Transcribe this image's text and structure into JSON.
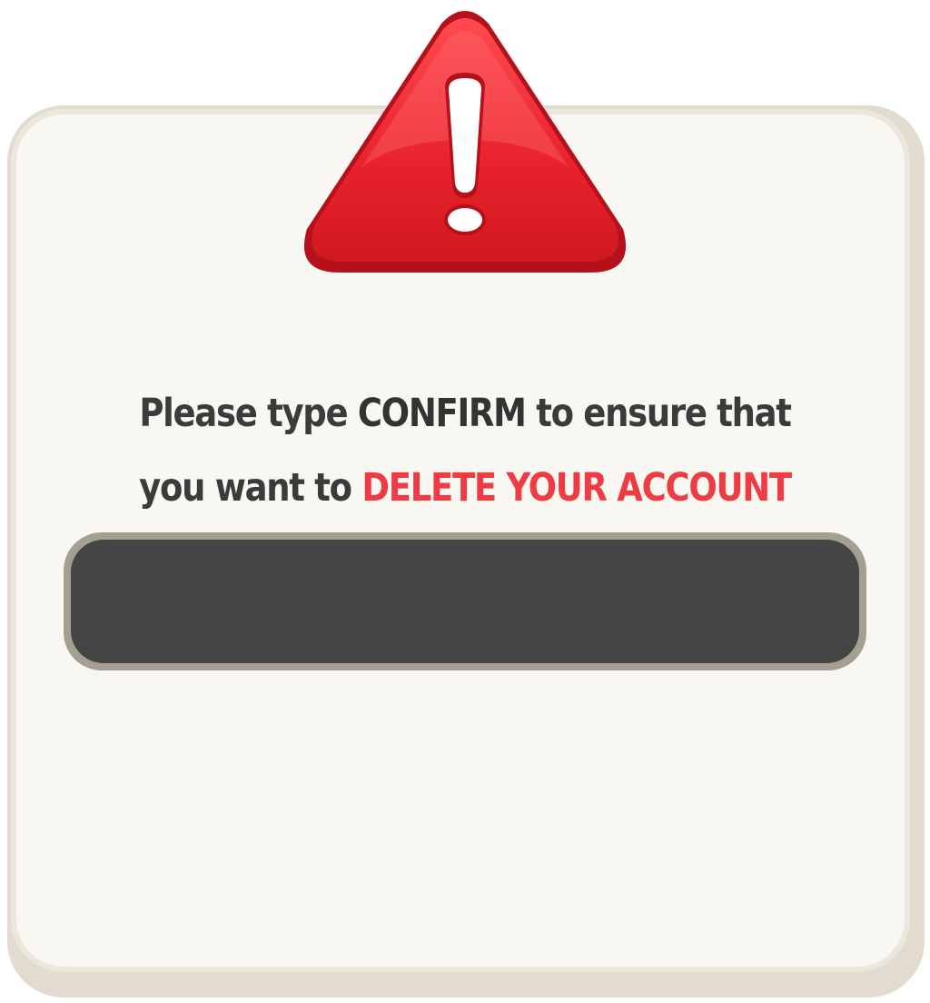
{
  "dialog": {
    "icon": "warning-triangle-icon",
    "message": {
      "part1": "Please type ",
      "keyword": "CONFIRM",
      "part2": " to ensure that",
      "part3": "you want to ",
      "danger": "DELETE YOUR ACCOUNT"
    },
    "input": {
      "value": "",
      "placeholder": ""
    }
  },
  "colors": {
    "danger": "#ef3b43",
    "text": "#3b3b3b",
    "panel": "#f8f7f2",
    "input_bg": "#454545",
    "warning_red": "#e8222c"
  }
}
